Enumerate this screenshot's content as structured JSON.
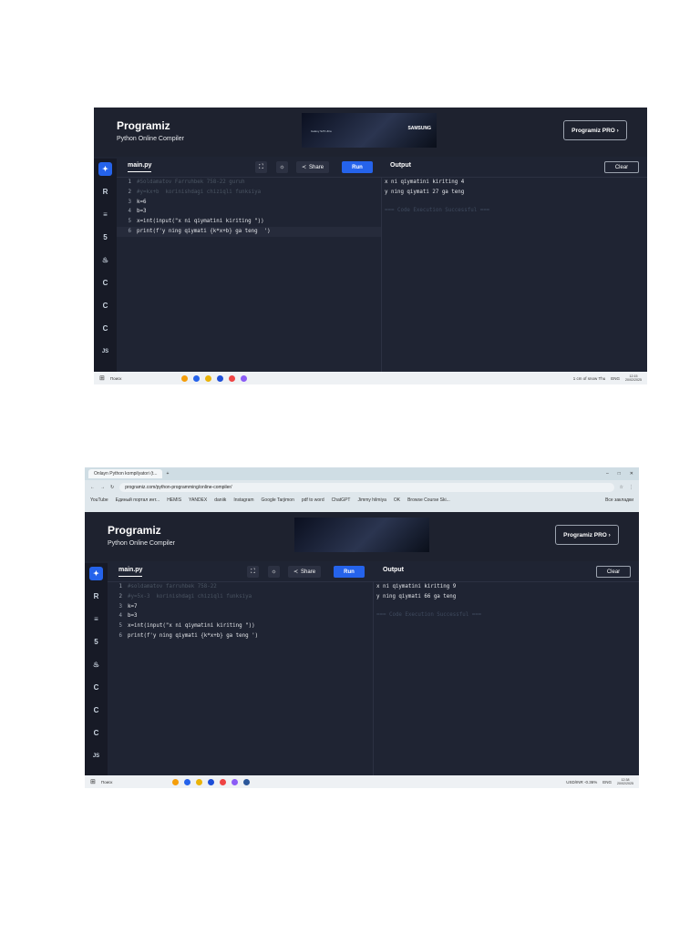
{
  "screenshot_1": {
    "logo": "Programiz",
    "logo_subtitle": "Python Online Compiler",
    "ad_brand": "SAMSUNG",
    "ad_text": "Galaxy S25 Ultra",
    "pro_button": "Programiz PRO ›",
    "file_tab": "main.py",
    "share_label": "Share",
    "run_label": "Run",
    "output_title": "Output",
    "clear_label": "Clear",
    "sidebar": [
      "python",
      "R",
      "sql",
      "html",
      "java",
      "c",
      "c++",
      "c#",
      "JS"
    ],
    "code": [
      {
        "n": "1",
        "text": "#Soldamatov Farruhbek 758-22 guruh"
      },
      {
        "n": "2",
        "text": "#y=kx+b  korinishdagi chiziqli funksiya"
      },
      {
        "n": "3",
        "text": "k=6"
      },
      {
        "n": "4",
        "text": "b=3"
      },
      {
        "n": "5",
        "text": "x=int(input(\"x ni qiymatini kiriting \"))"
      },
      {
        "n": "6",
        "text": "print(f'y ning qiymati {k*x+b} ga teng  ')"
      }
    ],
    "output": [
      "x ni qiymatini kiriting 4",
      "y ning qiymati 27 ga teng"
    ],
    "success": "=== Code Execution Successful ===",
    "taskbar": {
      "search": "Поиск",
      "weather": "1 cm of snow Thu",
      "lang": "ENG",
      "time": "12:15",
      "date": "20/02/2025"
    }
  },
  "screenshot_2": {
    "browser_tab": "Onlayn Python kompilyatori (t...",
    "url": "programiz.com/python-programming/online-compiler/",
    "bookmarks": [
      "YouTube",
      "Единый портал инт...",
      "HEMIS",
      "YANDEX",
      "daniik",
      "Instagram",
      "Google Tarjimon",
      "pdf to word",
      "ChatGPT",
      "Jimmy hilmiya",
      "OK",
      "Browse Course Ski..."
    ],
    "bookmarks_all": "Все закладки",
    "logo": "Programiz",
    "logo_subtitle": "Python Online Compiler",
    "pro_button": "Programiz PRO ›",
    "file_tab": "main.py",
    "share_label": "Share",
    "run_label": "Run",
    "output_title": "Output",
    "clear_label": "Clear",
    "sidebar": [
      "python",
      "R",
      "sql",
      "html",
      "java",
      "c",
      "c++",
      "c#",
      "JS"
    ],
    "code": [
      {
        "n": "1",
        "text": "#soldamatov farruhbek 758-22"
      },
      {
        "n": "2",
        "text": "#y=5x-3  korinishdagi chiziqli funksiya"
      },
      {
        "n": "3",
        "text": "k=7"
      },
      {
        "n": "4",
        "text": "b=3"
      },
      {
        "n": "5",
        "text": "x=int(input(\"x ni qiymatini kiriting \"))"
      },
      {
        "n": "6",
        "text": "print(f'y ning qiymati {k*x+b} ga teng ')"
      }
    ],
    "output": [
      "x ni qiymatini kiriting 9",
      "y ning qiymati 66 ga teng"
    ],
    "success": "=== Code Execution Successful ===",
    "taskbar": {
      "search": "Поиск",
      "weather": "USD/INR -0.36%",
      "lang": "ENG",
      "time": "12:38",
      "date": "20/02/2025"
    }
  }
}
